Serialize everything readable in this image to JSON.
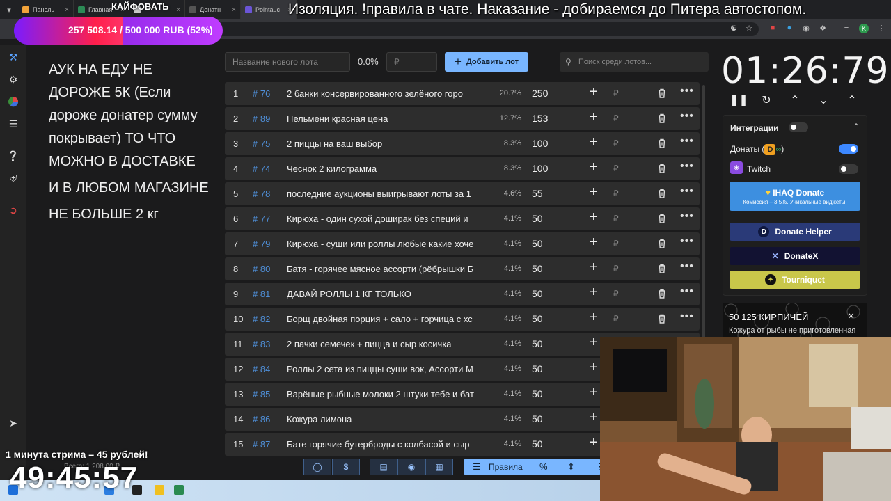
{
  "browser": {
    "tabs": [
      {
        "label": "Панель",
        "color": "#f2a33a"
      },
      {
        "label": "Главная",
        "color": "#2c8a55"
      },
      {
        "label": "",
        "color": "#c9c9c9"
      },
      {
        "label": "Донатн",
        "color": "#555555"
      },
      {
        "label": "Pointauc",
        "color": "#6b55d6"
      }
    ]
  },
  "overlay": {
    "title": "Изоляция. !правила в чате. Наказание - добираемся до Питера автостопом.",
    "kaif": "КАЙФОВАТЬ",
    "goal_text": "257 508.14 / 500 000 RUB (52%)",
    "goal_progress": 0.52,
    "minute_text": "1 минута стрима – 45 рублей!",
    "big_timer": "49:45:57",
    "muted_text": "Всего: 1 208.00 ₽"
  },
  "notes": [
    "АУК НА ЕДУ НЕ ДОРОЖЕ 5К (Если дороже донатер сумму покрывает) ТО ЧТО МОЖНО В ДОСТАВКЕ",
    "И В ЛЮБОМ МАГАЗИНЕ",
    "НЕ БОЛЬШЕ 2 кг"
  ],
  "controls": {
    "lot_placeholder": "Название нового лота",
    "percent": "0.0%",
    "rub_placeholder": "₽",
    "add_label": "Добавить лот",
    "search_placeholder": "Поиск среди лотов..."
  },
  "lots": [
    {
      "n": "1",
      "id": "# 76",
      "name": "2 банки консервированного зелёного горо",
      "pct": "20.7%",
      "amount": "250"
    },
    {
      "n": "2",
      "id": "# 89",
      "name": "Пельмени красная цена",
      "pct": "12.7%",
      "amount": "153"
    },
    {
      "n": "3",
      "id": "# 75",
      "name": "2 пиццы на ваш выбор",
      "pct": "8.3%",
      "amount": "100"
    },
    {
      "n": "4",
      "id": "# 74",
      "name": "Чеснок 2 килограмма",
      "pct": "8.3%",
      "amount": "100"
    },
    {
      "n": "5",
      "id": "# 78",
      "name": "последние аукционы выигрывают лоты за 1",
      "pct": "4.6%",
      "amount": "55"
    },
    {
      "n": "6",
      "id": "# 77",
      "name": "Кирюха - один сухой доширак без специй и",
      "pct": "4.1%",
      "amount": "50"
    },
    {
      "n": "7",
      "id": "# 79",
      "name": "Кирюха - суши или роллы любые какие хоче",
      "pct": "4.1%",
      "amount": "50"
    },
    {
      "n": "8",
      "id": "# 80",
      "name": "Батя - горячее мясное ассорти (рёбрышки Б",
      "pct": "4.1%",
      "amount": "50"
    },
    {
      "n": "9",
      "id": "# 81",
      "name": "ДАВАЙ РОЛЛЫ 1 КГ ТОЛЬКО",
      "pct": "4.1%",
      "amount": "50"
    },
    {
      "n": "10",
      "id": "# 82",
      "name": "Борщ двойная порция + сало + горчица с хс",
      "pct": "4.1%",
      "amount": "50"
    },
    {
      "n": "11",
      "id": "# 83",
      "name": "2 пачки семечек + пицца и сыр косичка",
      "pct": "4.1%",
      "amount": "50"
    },
    {
      "n": "12",
      "id": "# 84",
      "name": "Роллы 2 сета из пиццы суши вок, Ассорти М",
      "pct": "4.1%",
      "amount": "50"
    },
    {
      "n": "13",
      "id": "# 85",
      "name": "Варёные рыбные молоки 2 штуки тебе и бат",
      "pct": "4.1%",
      "amount": "50"
    },
    {
      "n": "14",
      "id": "# 86",
      "name": "Кожура лимона",
      "pct": "4.1%",
      "amount": "50"
    },
    {
      "n": "15",
      "id": "# 87",
      "name": "Бате горячие бутерброды с колбасой и сыр",
      "pct": "4.1%",
      "amount": "50"
    }
  ],
  "rub_symbol": "₽",
  "timer": "01:26:79",
  "rules_label": "Правила",
  "integrations": {
    "title": "Интеграции",
    "donations": "Донаты (",
    "donations_close": ")",
    "twitch": "Twitch",
    "ihaq_title": "IHAQ Donate",
    "ihaq_sub": "Комиссия – 3,5%. Уникальные виджеты!",
    "donate_helper": "Donate Helper",
    "donatex": "DonateX",
    "tourniquet": "Tourniquet"
  },
  "banner": {
    "line1": "50 125 КИРПИЧЕЙ",
    "line2": "Кожура от рыбы не приготовленная"
  },
  "colors": {
    "accent": "#79b6ff",
    "id_blue": "#4f8fd8",
    "danger": "#e04545",
    "ihaq": "#3d8fe0",
    "donate_helper": "#2a3a78",
    "tourniquet": "#c9c74a"
  }
}
